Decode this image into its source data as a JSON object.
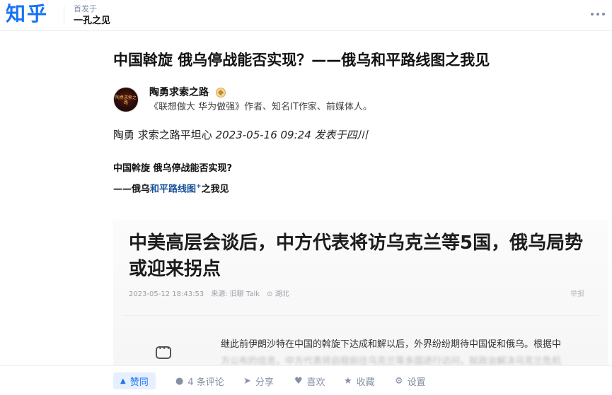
{
  "header": {
    "logo": "知乎",
    "published_in_label": "首发于",
    "column_name": "一孔之见"
  },
  "article": {
    "title": "中国斡旋 俄乌停战能否实现？——俄乌和平路线图之我见",
    "author": {
      "name": "陶勇求索之路",
      "bio": "《联想做大 华为做强》作者、知名IT作家、前媒体人。",
      "avatar_text": "陶勇求索之路"
    },
    "byline_prefix": "陶勇 求索之路平坦心",
    "byline_meta": "2023-05-16 09:24 发表于四川",
    "subtitle_line1": "中国斡旋 俄乌停战能否实现?",
    "subtitle_line2_prefix": "——俄乌",
    "subtitle_line2_link": "和平路线图",
    "subtitle_line2_sup": "+",
    "subtitle_line2_suffix": "之我见"
  },
  "embed": {
    "title": "中美高层会谈后，中方代表将访乌克兰等5国，俄乌局势或迎来拐点",
    "meta": "2023-05-12 18:43:53　来源: 旧聊 Talk　⊙ 湖北",
    "report": "举报",
    "body_line1": "继此前伊朗沙特在中国的斡旋下达成和解以后，外界纷纷期待中国促和俄乌。根据中",
    "body_line2": "方公布的信息，中方代表将启程前往乌克兰等多国进行访问，就政治解决乌克兰危机"
  },
  "actions": {
    "upvote": "赞同",
    "comments": "4 条评论",
    "share": "分享",
    "like": "喜欢",
    "favorite": "收藏",
    "settings": "设置"
  },
  "colors": {
    "brand": "#1772f6",
    "link": "#175199",
    "muted": "#8590a6"
  }
}
